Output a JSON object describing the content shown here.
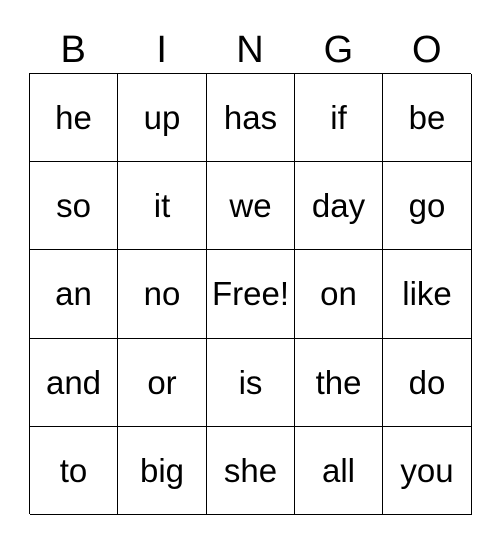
{
  "header": [
    "B",
    "I",
    "N",
    "G",
    "O"
  ],
  "rows": [
    [
      "he",
      "up",
      "has",
      "if",
      "be"
    ],
    [
      "so",
      "it",
      "we",
      "day",
      "go"
    ],
    [
      "an",
      "no",
      "Free!",
      "on",
      "like"
    ],
    [
      "and",
      "or",
      "is",
      "the",
      "do"
    ],
    [
      "to",
      "big",
      "she",
      "all",
      "you"
    ]
  ]
}
